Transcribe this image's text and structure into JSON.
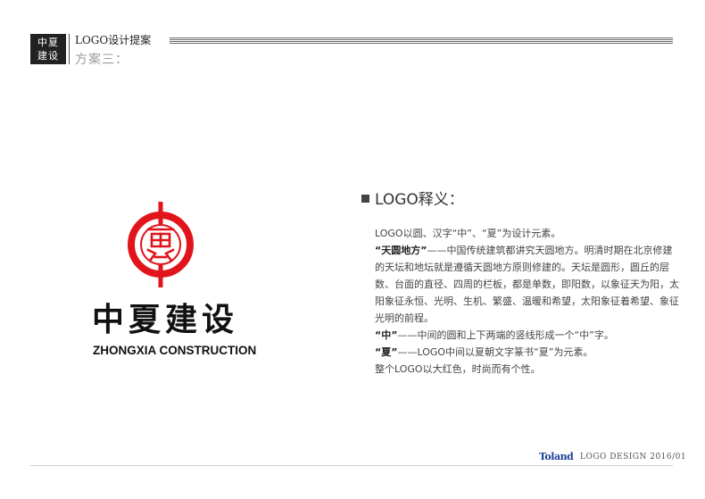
{
  "header": {
    "badge_line1": "中夏",
    "badge_line2": "建设",
    "title": "LOGO设计提案",
    "subtitle": "方案三："
  },
  "logo": {
    "name_cn": "中夏建设",
    "name_en": "ZHONGXIA CONSTRUCTION",
    "primary_color": "#e1141c"
  },
  "section": {
    "title": "LOGO释义："
  },
  "paragraphs": {
    "p1": "LOGO以圆、汉字“中”、“夏”为设计元素。",
    "p2_bold": "“天圆地方”",
    "p2": "——中国传统建筑都讲究天圆地方。明清时期在北京修建的天坛和地坛就是遵循天圆地方原则修建的。天坛是圆形，圆丘的层数、台面的直径、四周的栏板，都是单数，即阳数，以象征天为阳，太阳象征永恒、光明、生机、繁盛、温暖和希望，太阳象征着希望、象征光明的前程。",
    "p3_bold": "“中”",
    "p3": "——中间的圆和上下两端的竖线形成一个“中”字。",
    "p4_bold": "“夏”",
    "p4": "——LOGO中间以夏朝文字篆书“夏”为元素。",
    "p5": "整个LOGO以大红色，时尚而有个性。"
  },
  "footer": {
    "brand": "Toland",
    "text": "LOGO DESIGN  2016/01"
  }
}
